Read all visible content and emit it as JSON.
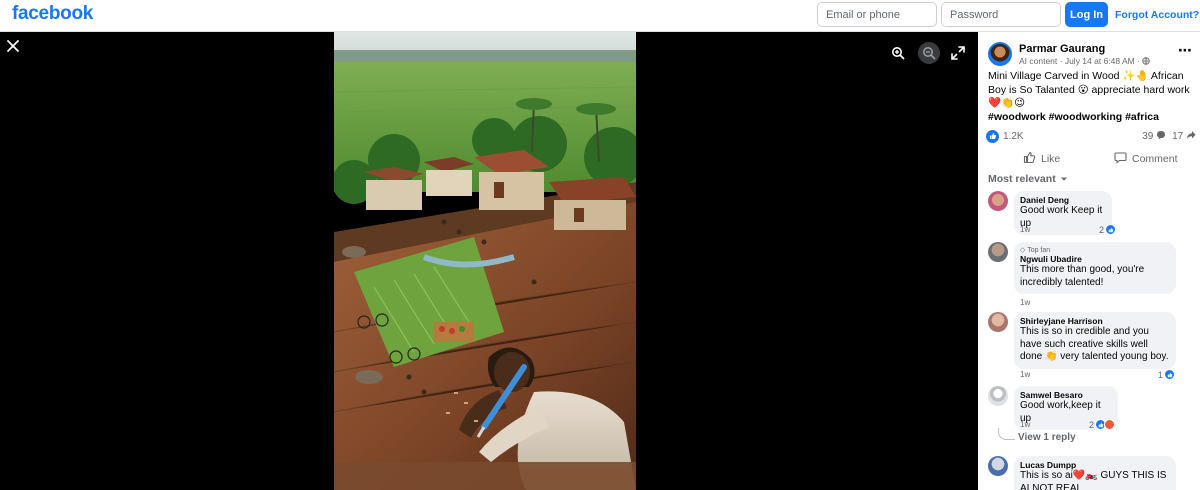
{
  "header": {
    "logo_text": "facebook",
    "email_placeholder": "Email or phone",
    "password_placeholder": "Password",
    "login_label": "Log In",
    "forgot_label": "Forgot Account?"
  },
  "viewer": {
    "close_icon": "close-icon",
    "zoom_in_icon": "zoom-in-icon",
    "zoom_out_icon": "zoom-out-icon",
    "fullscreen_icon": "fullscreen-icon"
  },
  "post": {
    "author": "Parmar Gaurang",
    "meta": "AI content · July 14 at 6:48 AM · ",
    "caption": "Mini Village Carved in Wood ✨🤚 African Boy is So Talanted 😮 appreciate hard work❤️👏😉",
    "tags": "#woodwork #woodworking #africa",
    "reactions_count": "1.2K",
    "comments_count": "39",
    "shares_count": "17",
    "like_label": "Like",
    "comment_label": "Comment",
    "sort_label": "Most relevant"
  },
  "comments": [
    {
      "name": "Daniel Deng",
      "text": "Good work Keep it up",
      "time": "1w",
      "reactions": "2",
      "badge": ""
    },
    {
      "name": "Ngwuli Ubadire",
      "text": "This more than good, you're incredibly talented!",
      "time": "1w",
      "reactions": "",
      "badge": "Top fan"
    },
    {
      "name": "Shirleyjane Harrison",
      "text": "This is so in credible and you have such creative skills well done 👏 very talented young boy.",
      "time": "1w",
      "reactions": "1",
      "badge": ""
    },
    {
      "name": "Samwel Besaro",
      "text": "Good work,keep it up",
      "time": "1w",
      "reactions": "2",
      "badge": ""
    },
    {
      "name": "Lucas Dumpp",
      "text": "This is so ai❤️🏍️ GUYS THIS IS AI NOT REAL",
      "time": "",
      "reactions": "",
      "badge": ""
    }
  ],
  "view_reply_label": "View 1 reply",
  "colors": {
    "brand": "#1877f2",
    "bubble": "#f0f2f5",
    "secondary_text": "#65676b"
  }
}
